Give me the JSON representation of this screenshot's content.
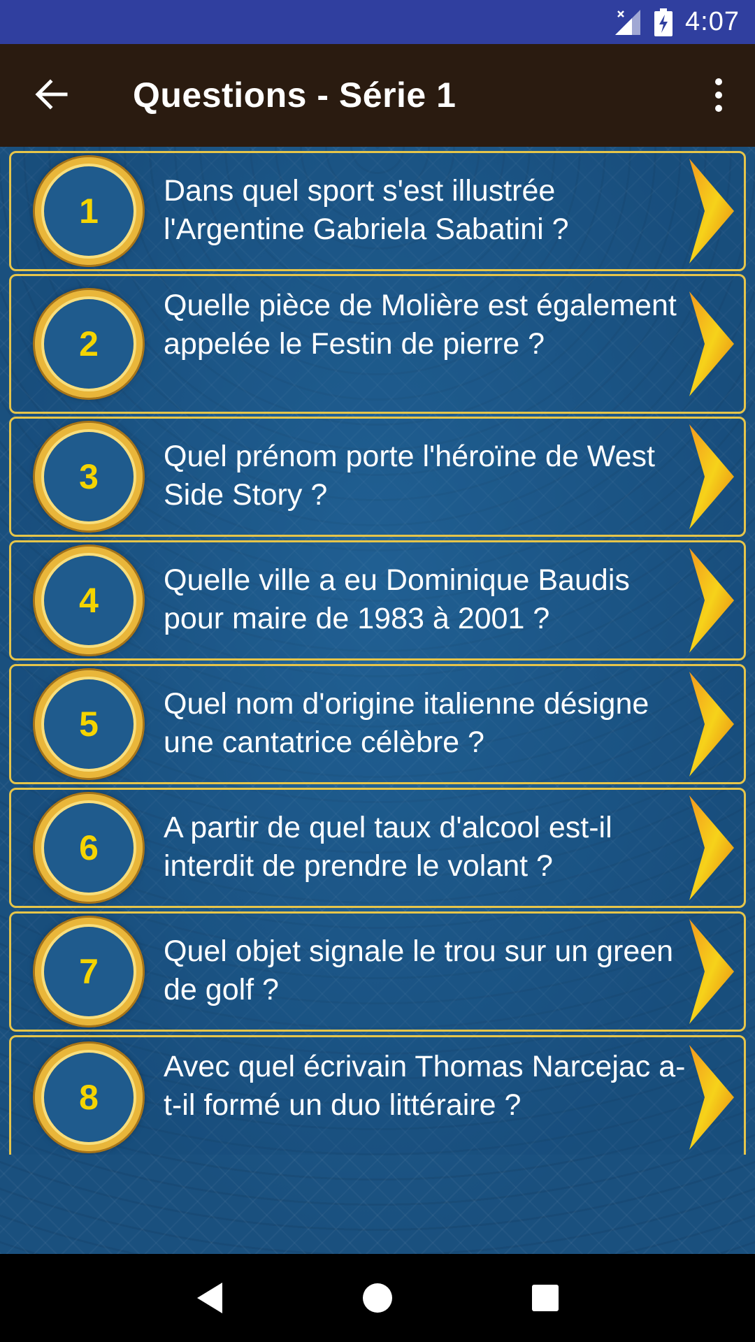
{
  "status_bar": {
    "time": "4:07",
    "icons": [
      "signal-no-data-icon",
      "battery-charging-icon"
    ]
  },
  "app_bar": {
    "title": "Questions - Série 1",
    "back_icon": "arrow-back-icon",
    "menu_icon": "more-vert-icon"
  },
  "questions": [
    {
      "number": "1",
      "text": "Dans quel sport s'est illustrée l'Argentine Gabriela Sabatini ?"
    },
    {
      "number": "2",
      "text": "Quelle pièce de Molière est également appelée le Festin de pierre ?"
    },
    {
      "number": "3",
      "text": "Quel prénom porte l'héroïne de West Side Story ?"
    },
    {
      "number": "4",
      "text": "Quelle ville a eu Dominique Baudis pour maire de 1983 à 2001 ?"
    },
    {
      "number": "5",
      "text": "Quel nom d'origine italienne désigne une cantatrice célèbre ?"
    },
    {
      "number": "6",
      "text": "A partir de quel taux d'alcool est-il interdit de prendre le volant ?"
    },
    {
      "number": "7",
      "text": "Quel objet signale le trou sur un green de golf ?"
    },
    {
      "number": "8",
      "text": "Avec quel écrivain Thomas Narcejac a-t-il formé un duo littéraire ?"
    }
  ],
  "nav_bar": {
    "icons": [
      "back-triangle-icon",
      "home-circle-icon",
      "recents-square-icon"
    ]
  },
  "colors": {
    "status_bar": "#303f9f",
    "app_bar": "#2a1b10",
    "item_border": "#e6c54a",
    "number": "#f5d400",
    "badge_ring": "#e9b63a"
  }
}
